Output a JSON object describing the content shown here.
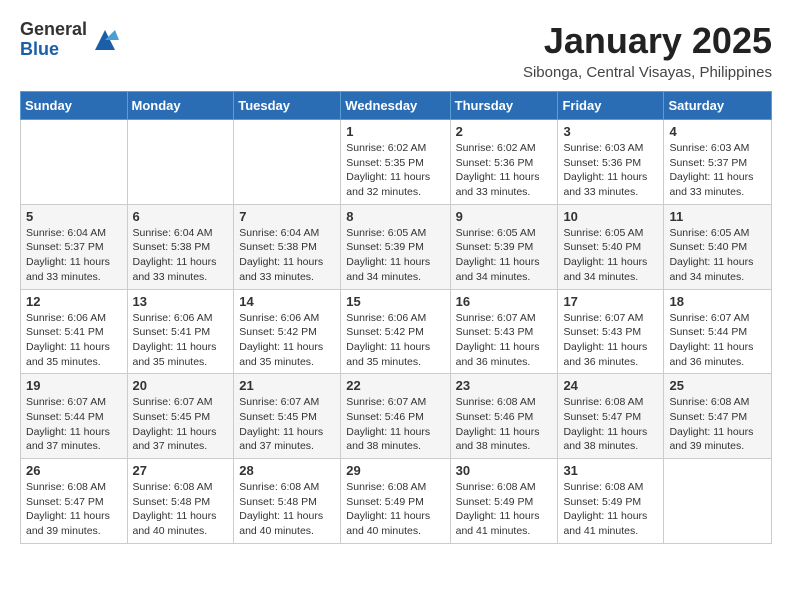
{
  "header": {
    "logo": {
      "general": "General",
      "blue": "Blue"
    },
    "title": "January 2025",
    "subtitle": "Sibonga, Central Visayas, Philippines"
  },
  "weekdays": [
    "Sunday",
    "Monday",
    "Tuesday",
    "Wednesday",
    "Thursday",
    "Friday",
    "Saturday"
  ],
  "weeks": [
    [
      {
        "day": "",
        "info": ""
      },
      {
        "day": "",
        "info": ""
      },
      {
        "day": "",
        "info": ""
      },
      {
        "day": "1",
        "info": "Sunrise: 6:02 AM\nSunset: 5:35 PM\nDaylight: 11 hours and 32 minutes."
      },
      {
        "day": "2",
        "info": "Sunrise: 6:02 AM\nSunset: 5:36 PM\nDaylight: 11 hours and 33 minutes."
      },
      {
        "day": "3",
        "info": "Sunrise: 6:03 AM\nSunset: 5:36 PM\nDaylight: 11 hours and 33 minutes."
      },
      {
        "day": "4",
        "info": "Sunrise: 6:03 AM\nSunset: 5:37 PM\nDaylight: 11 hours and 33 minutes."
      }
    ],
    [
      {
        "day": "5",
        "info": "Sunrise: 6:04 AM\nSunset: 5:37 PM\nDaylight: 11 hours and 33 minutes."
      },
      {
        "day": "6",
        "info": "Sunrise: 6:04 AM\nSunset: 5:38 PM\nDaylight: 11 hours and 33 minutes."
      },
      {
        "day": "7",
        "info": "Sunrise: 6:04 AM\nSunset: 5:38 PM\nDaylight: 11 hours and 33 minutes."
      },
      {
        "day": "8",
        "info": "Sunrise: 6:05 AM\nSunset: 5:39 PM\nDaylight: 11 hours and 34 minutes."
      },
      {
        "day": "9",
        "info": "Sunrise: 6:05 AM\nSunset: 5:39 PM\nDaylight: 11 hours and 34 minutes."
      },
      {
        "day": "10",
        "info": "Sunrise: 6:05 AM\nSunset: 5:40 PM\nDaylight: 11 hours and 34 minutes."
      },
      {
        "day": "11",
        "info": "Sunrise: 6:05 AM\nSunset: 5:40 PM\nDaylight: 11 hours and 34 minutes."
      }
    ],
    [
      {
        "day": "12",
        "info": "Sunrise: 6:06 AM\nSunset: 5:41 PM\nDaylight: 11 hours and 35 minutes."
      },
      {
        "day": "13",
        "info": "Sunrise: 6:06 AM\nSunset: 5:41 PM\nDaylight: 11 hours and 35 minutes."
      },
      {
        "day": "14",
        "info": "Sunrise: 6:06 AM\nSunset: 5:42 PM\nDaylight: 11 hours and 35 minutes."
      },
      {
        "day": "15",
        "info": "Sunrise: 6:06 AM\nSunset: 5:42 PM\nDaylight: 11 hours and 35 minutes."
      },
      {
        "day": "16",
        "info": "Sunrise: 6:07 AM\nSunset: 5:43 PM\nDaylight: 11 hours and 36 minutes."
      },
      {
        "day": "17",
        "info": "Sunrise: 6:07 AM\nSunset: 5:43 PM\nDaylight: 11 hours and 36 minutes."
      },
      {
        "day": "18",
        "info": "Sunrise: 6:07 AM\nSunset: 5:44 PM\nDaylight: 11 hours and 36 minutes."
      }
    ],
    [
      {
        "day": "19",
        "info": "Sunrise: 6:07 AM\nSunset: 5:44 PM\nDaylight: 11 hours and 37 minutes."
      },
      {
        "day": "20",
        "info": "Sunrise: 6:07 AM\nSunset: 5:45 PM\nDaylight: 11 hours and 37 minutes."
      },
      {
        "day": "21",
        "info": "Sunrise: 6:07 AM\nSunset: 5:45 PM\nDaylight: 11 hours and 37 minutes."
      },
      {
        "day": "22",
        "info": "Sunrise: 6:07 AM\nSunset: 5:46 PM\nDaylight: 11 hours and 38 minutes."
      },
      {
        "day": "23",
        "info": "Sunrise: 6:08 AM\nSunset: 5:46 PM\nDaylight: 11 hours and 38 minutes."
      },
      {
        "day": "24",
        "info": "Sunrise: 6:08 AM\nSunset: 5:47 PM\nDaylight: 11 hours and 38 minutes."
      },
      {
        "day": "25",
        "info": "Sunrise: 6:08 AM\nSunset: 5:47 PM\nDaylight: 11 hours and 39 minutes."
      }
    ],
    [
      {
        "day": "26",
        "info": "Sunrise: 6:08 AM\nSunset: 5:47 PM\nDaylight: 11 hours and 39 minutes."
      },
      {
        "day": "27",
        "info": "Sunrise: 6:08 AM\nSunset: 5:48 PM\nDaylight: 11 hours and 40 minutes."
      },
      {
        "day": "28",
        "info": "Sunrise: 6:08 AM\nSunset: 5:48 PM\nDaylight: 11 hours and 40 minutes."
      },
      {
        "day": "29",
        "info": "Sunrise: 6:08 AM\nSunset: 5:49 PM\nDaylight: 11 hours and 40 minutes."
      },
      {
        "day": "30",
        "info": "Sunrise: 6:08 AM\nSunset: 5:49 PM\nDaylight: 11 hours and 41 minutes."
      },
      {
        "day": "31",
        "info": "Sunrise: 6:08 AM\nSunset: 5:49 PM\nDaylight: 11 hours and 41 minutes."
      },
      {
        "day": "",
        "info": ""
      }
    ]
  ]
}
